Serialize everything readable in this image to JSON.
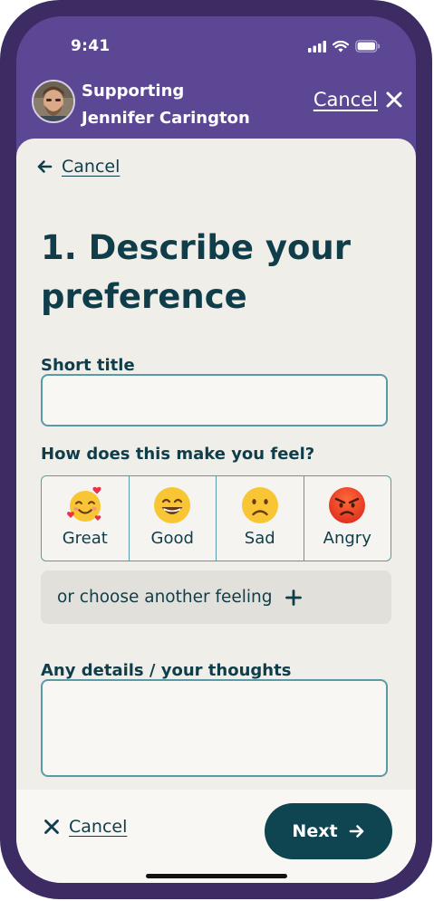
{
  "status_bar": {
    "time": "9:41"
  },
  "header": {
    "supporting_label": "Supporting",
    "person_name": "Jennifer Carington",
    "cancel_label": "Cancel"
  },
  "nav": {
    "back_label": "Cancel"
  },
  "page": {
    "title": "1. Describe your preference"
  },
  "form": {
    "short_title_label": "Short title",
    "short_title_value": "",
    "feel_label": "How does this make you feel?",
    "feelings": [
      {
        "label": "Great",
        "icon": "smiling-face-with-hearts-icon"
      },
      {
        "label": "Good",
        "icon": "grinning-face-icon"
      },
      {
        "label": "Sad",
        "icon": "frowning-face-icon"
      },
      {
        "label": "Angry",
        "icon": "angry-face-icon"
      }
    ],
    "other_feeling_label": "or choose another feeling",
    "details_label": "Any details / your thoughts",
    "details_value": ""
  },
  "footer": {
    "cancel_label": "Cancel",
    "next_label": "Next"
  },
  "colors": {
    "header_bg": "#5c4795",
    "frame": "#3c2c63",
    "sheet_bg": "#efeee9",
    "primary_text": "#0f3d4a",
    "input_border": "#5a9aa6",
    "next_button_bg": "#0f4550"
  }
}
